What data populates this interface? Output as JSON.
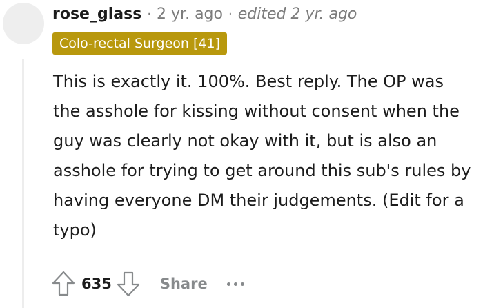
{
  "comment": {
    "author": "rose_glass",
    "separator": "·",
    "time": "2 yr. ago",
    "edited": "edited 2 yr. ago",
    "flair": "Colo-rectal Surgeon [41]",
    "body": "This is exactly it. 100%. Best reply. The OP was the asshole for kissing without consent when the guy was clearly not okay with it, but is also an asshole for trying to get around this sub's rules by having everyone DM their judgements. (Edit for a typo)",
    "score": "635",
    "share_label": "Share",
    "icons": {
      "upvote": "upvote-arrow-icon",
      "downvote": "downvote-arrow-icon",
      "more": "more-options-icon"
    }
  },
  "colors": {
    "flair_background": "#b8980d",
    "flair_text": "#ffffff",
    "meta_text": "#7c7c7c",
    "action_text": "#878a8c"
  }
}
